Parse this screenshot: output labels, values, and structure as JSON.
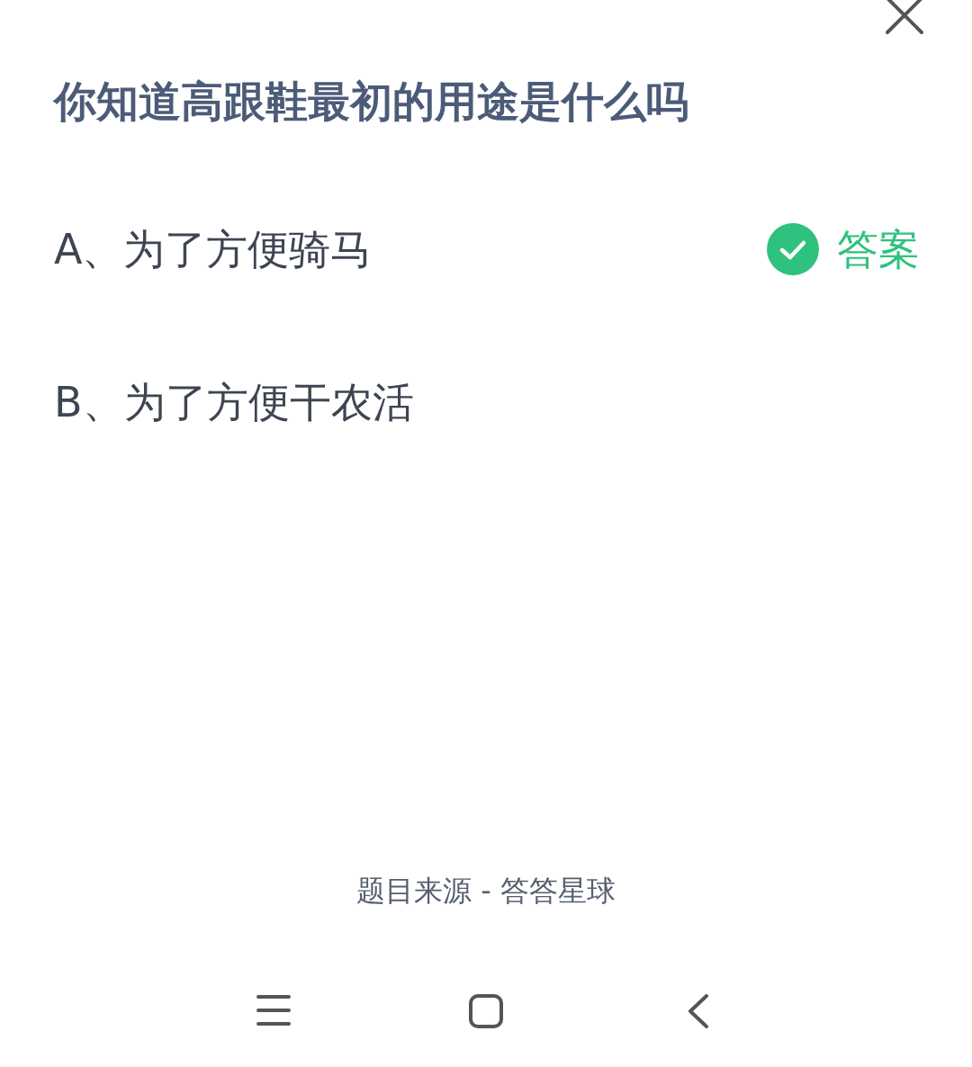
{
  "question": "你知道高跟鞋最初的用途是什么吗",
  "options": [
    {
      "text": "A、为了方便骑马",
      "answer": true
    },
    {
      "text": "B、为了方便干农活",
      "answer": false
    }
  ],
  "answer_label": "答案",
  "source": "题目来源 - 答答星球",
  "nav": [
    {
      "kind": "menu"
    },
    {
      "kind": "home"
    },
    {
      "kind": "back"
    }
  ]
}
